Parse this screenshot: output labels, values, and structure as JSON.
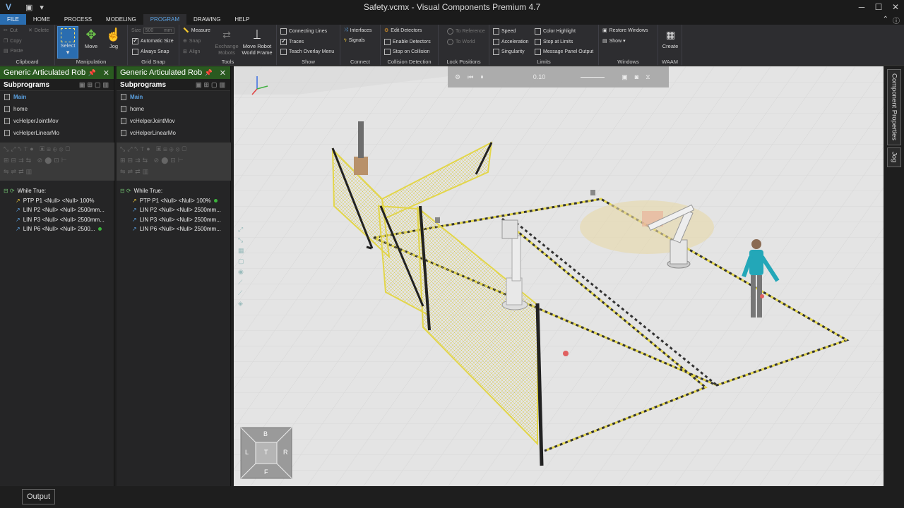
{
  "window": {
    "title": "Safety.vcmx - Visual Components Premium 4.7",
    "minimize": "─",
    "maximize": "☐",
    "close": "✕"
  },
  "menu": {
    "tabs": [
      "FILE",
      "HOME",
      "PROCESS",
      "MODELING",
      "PROGRAM",
      "DRAWING",
      "HELP"
    ],
    "active": "PROGRAM",
    "help_icon": "?",
    "info_icon": "ⓘ"
  },
  "ribbon": {
    "clipboard": {
      "label": "Clipboard",
      "cut": "Cut",
      "delete": "Delete",
      "copy": "Copy",
      "paste": "Paste"
    },
    "manipulation": {
      "label": "Manipulation",
      "select": "Select",
      "move": "Move",
      "jog": "Jog"
    },
    "grid_snap": {
      "label": "Grid Snap",
      "size_label": "Size",
      "size_value": "500",
      "size_unit": "mm",
      "automatic_size": "Automatic Size",
      "always_snap": "Always Snap"
    },
    "tools": {
      "label": "Tools",
      "measure": "Measure",
      "snap": "Snap",
      "align": "Align",
      "exchange_robots": "Exchange Robots",
      "move_robot_world_frame": "Move Robot World Frame"
    },
    "show": {
      "label": "Show",
      "connecting_lines": "Connecting Lines",
      "traces": "Traces",
      "teach_overlay_menu": "Teach Overlay Menu"
    },
    "connect": {
      "label": "Connect",
      "interfaces": "Interfaces",
      "signals": "Signals"
    },
    "collision_detection": {
      "label": "Collision Detection",
      "edit_detectors": "Edit Detectors",
      "enable_detectors": "Enable Detectors",
      "stop_on_collision": "Stop on Collision"
    },
    "lock_positions": {
      "label": "Lock Positions",
      "to_reference": "To Reference",
      "to_world": "To World"
    },
    "limits": {
      "label": "Limits",
      "speed": "Speed",
      "acceleration": "Acceleration",
      "singularity": "Singularity",
      "color_highlight": "Color Highlight",
      "stop_at_limits": "Stop at Limits",
      "message_panel_output": "Message Panel Output"
    },
    "windows": {
      "label": "Windows",
      "restore_windows": "Restore Windows",
      "show": "Show ▾"
    },
    "waam": {
      "label": "WAAM",
      "create": "Create"
    }
  },
  "panels": [
    {
      "title": "Generic Articulated Rob",
      "subprograms": "Subprograms",
      "items": [
        "Main",
        "home",
        "vcHelperJointMov",
        "vcHelperLinearMo"
      ],
      "tree_root": "While True:",
      "statements": [
        "PTP P1 <Null> <Null> 100%",
        "LIN P2 <Null> <Null> 2500mm...",
        "LIN P3 <Null> <Null> 2500mm...",
        "LIN P6 <Null> <Null> 2500..."
      ]
    },
    {
      "title": "Generic Articulated Rob",
      "subprograms": "Subprograms",
      "items": [
        "Main",
        "home",
        "vcHelperJointMov",
        "vcHelperLinearMo"
      ],
      "tree_root": "While True:",
      "statements": [
        "PTP P1 <Null> <Null> 100%",
        "LIN P2 <Null> <Null> 2500mm...",
        "LIN P3 <Null> <Null> 2500mm...",
        "LIN P6 <Null> <Null> 2500mm..."
      ]
    }
  ],
  "viewport": {
    "sim_time": "0.10",
    "navcube": {
      "top": "B",
      "left": "L",
      "center": "T",
      "right": "R",
      "bottom": "F"
    }
  },
  "right_tabs": [
    "Component Properties",
    "Jog"
  ],
  "status": {
    "output": "Output"
  },
  "colors": {
    "accent": "#2a6db0",
    "panel_header": "#2a5a20",
    "fence_yellow": "#e3d64a",
    "floor": "#e2e2e2"
  }
}
